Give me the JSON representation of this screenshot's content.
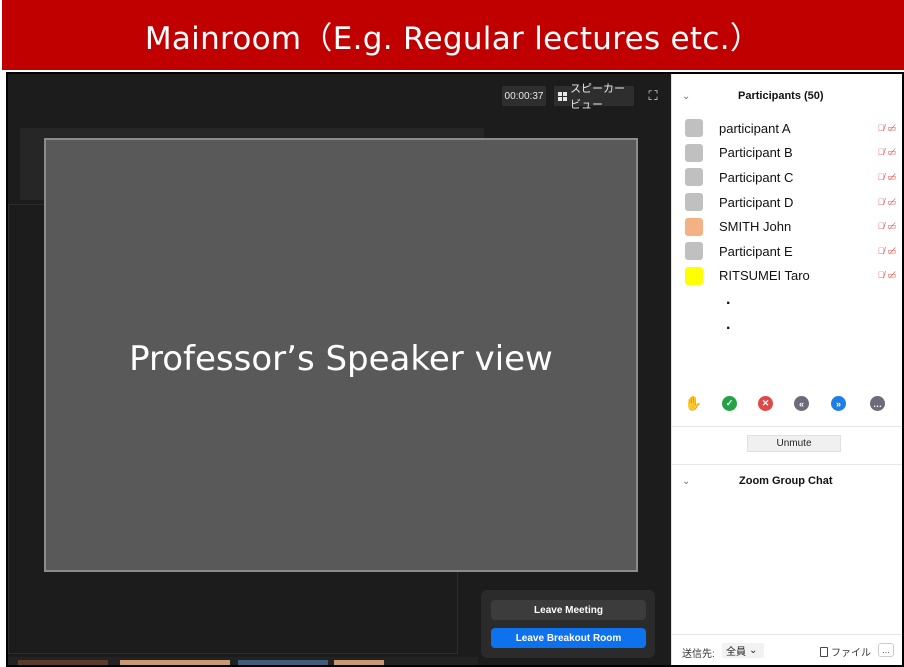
{
  "banner": {
    "title": "Mainroom（E.g. Regular lectures etc.）"
  },
  "toolbar": {
    "timer": "00:00:37",
    "speaker_view_label": "スピーカービュー",
    "fullscreen_icon": "fullscreen-icon"
  },
  "main_view": {
    "label": "Professor’s Speaker view"
  },
  "leave": {
    "meeting_label": "Leave Meeting",
    "breakout_label": "Leave Breakout Room"
  },
  "participants": {
    "title": "Participants (50)",
    "items": [
      {
        "name": "participant A",
        "avatar_color": "#c0c0c0"
      },
      {
        "name": "Participant B",
        "avatar_color": "#c0c0c0"
      },
      {
        "name": "Participant C",
        "avatar_color": "#c0c0c0"
      },
      {
        "name": "Participant D",
        "avatar_color": "#c0c0c0"
      },
      {
        "name": "SMITH John",
        "avatar_color": "#f4b183"
      },
      {
        "name": "Participant E",
        "avatar_color": "#c0c0c0"
      },
      {
        "name": "RITSUMEI Taro",
        "avatar_color": "#ffff00"
      }
    ],
    "more_dots": [
      ".",
      "."
    ]
  },
  "reactions": [
    {
      "name": "raise-hand-icon",
      "color": "#2d6be0"
    },
    {
      "name": "yes-icon",
      "color": "#23a346"
    },
    {
      "name": "no-icon",
      "color": "#e04848"
    },
    {
      "name": "go-slower-icon",
      "color": "#6b6b7a"
    },
    {
      "name": "go-faster-icon",
      "color": "#1e7ee8"
    },
    {
      "name": "more-icon",
      "color": "#6b6b7a"
    }
  ],
  "unmute_label": "Unmute",
  "chat": {
    "title": "Zoom Group Chat",
    "send_to_label": "送信先:",
    "recipient": "全員",
    "file_label": "ファイル",
    "more_label": "..."
  },
  "colors": {
    "banner": "#c00000",
    "leave_breakout": "#0e72ed",
    "speaker_view_bg": "#595959"
  }
}
